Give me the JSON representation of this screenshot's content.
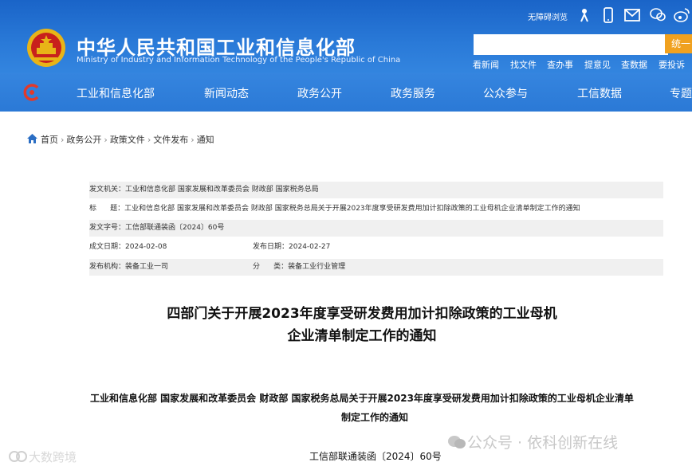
{
  "header": {
    "title": "中华人民共和国工业和信息化部",
    "subtitle": "Ministry of Industry and Information Technology of the People's Republic of China",
    "accessibility": "无障碍浏览",
    "search_button": "统一",
    "quick_links": [
      "看新闻",
      "找文件",
      "查办事",
      "提意见",
      "查数据",
      "要投诉"
    ]
  },
  "nav": {
    "items": [
      "工业和信息化部",
      "新闻动态",
      "政务公开",
      "政务服务",
      "公众参与",
      "工信数据",
      "专题"
    ]
  },
  "breadcrumb": {
    "items": [
      "首页",
      "政务公开",
      "政策文件",
      "文件发布",
      "通知"
    ],
    "separator": "›"
  },
  "meta": {
    "issuer_label": "发文机关：",
    "issuer": "工业和信息化部 国家发展和改革委员会 财政部 国家税务总局",
    "title_label": "标      题：",
    "title": "工业和信息化部 国家发展和改革委员会 财政部 国家税务总局关于开展2023年度享受研发费用加计扣除政策的工业母机企业清单制定工作的通知",
    "docno_label": "发文字号：",
    "docno": "工信部联通装函〔2024〕60号",
    "created_label": "成文日期：",
    "created": "2024-02-08",
    "published_label": "发布日期：",
    "published": "2024-02-27",
    "org_label": "发布机构：",
    "org": "装备工业一司",
    "category_label": "分      类：",
    "category": "装备工业行业管理"
  },
  "article": {
    "title_line1": "四部门关于开展2023年度享受研发费用加计扣除政策的工业母机",
    "title_line2": "企业清单制定工作的通知",
    "heading_line1": "工业和信息化部 国家发展和改革委员会 财政部 国家税务总局关于开展2023年度享受研发费用加计扣除政策的工业母机企业清单",
    "heading_line2": "制定工作的通知",
    "docno": "工信部联通装函〔2024〕60号"
  },
  "watermarks": {
    "left": "大数跨境",
    "right": "公众号 · 依科创新在线"
  },
  "colors": {
    "header_blue": "#1a64c8",
    "nav_blue": "#2b79d6",
    "search_orange": "#f0a11f"
  }
}
